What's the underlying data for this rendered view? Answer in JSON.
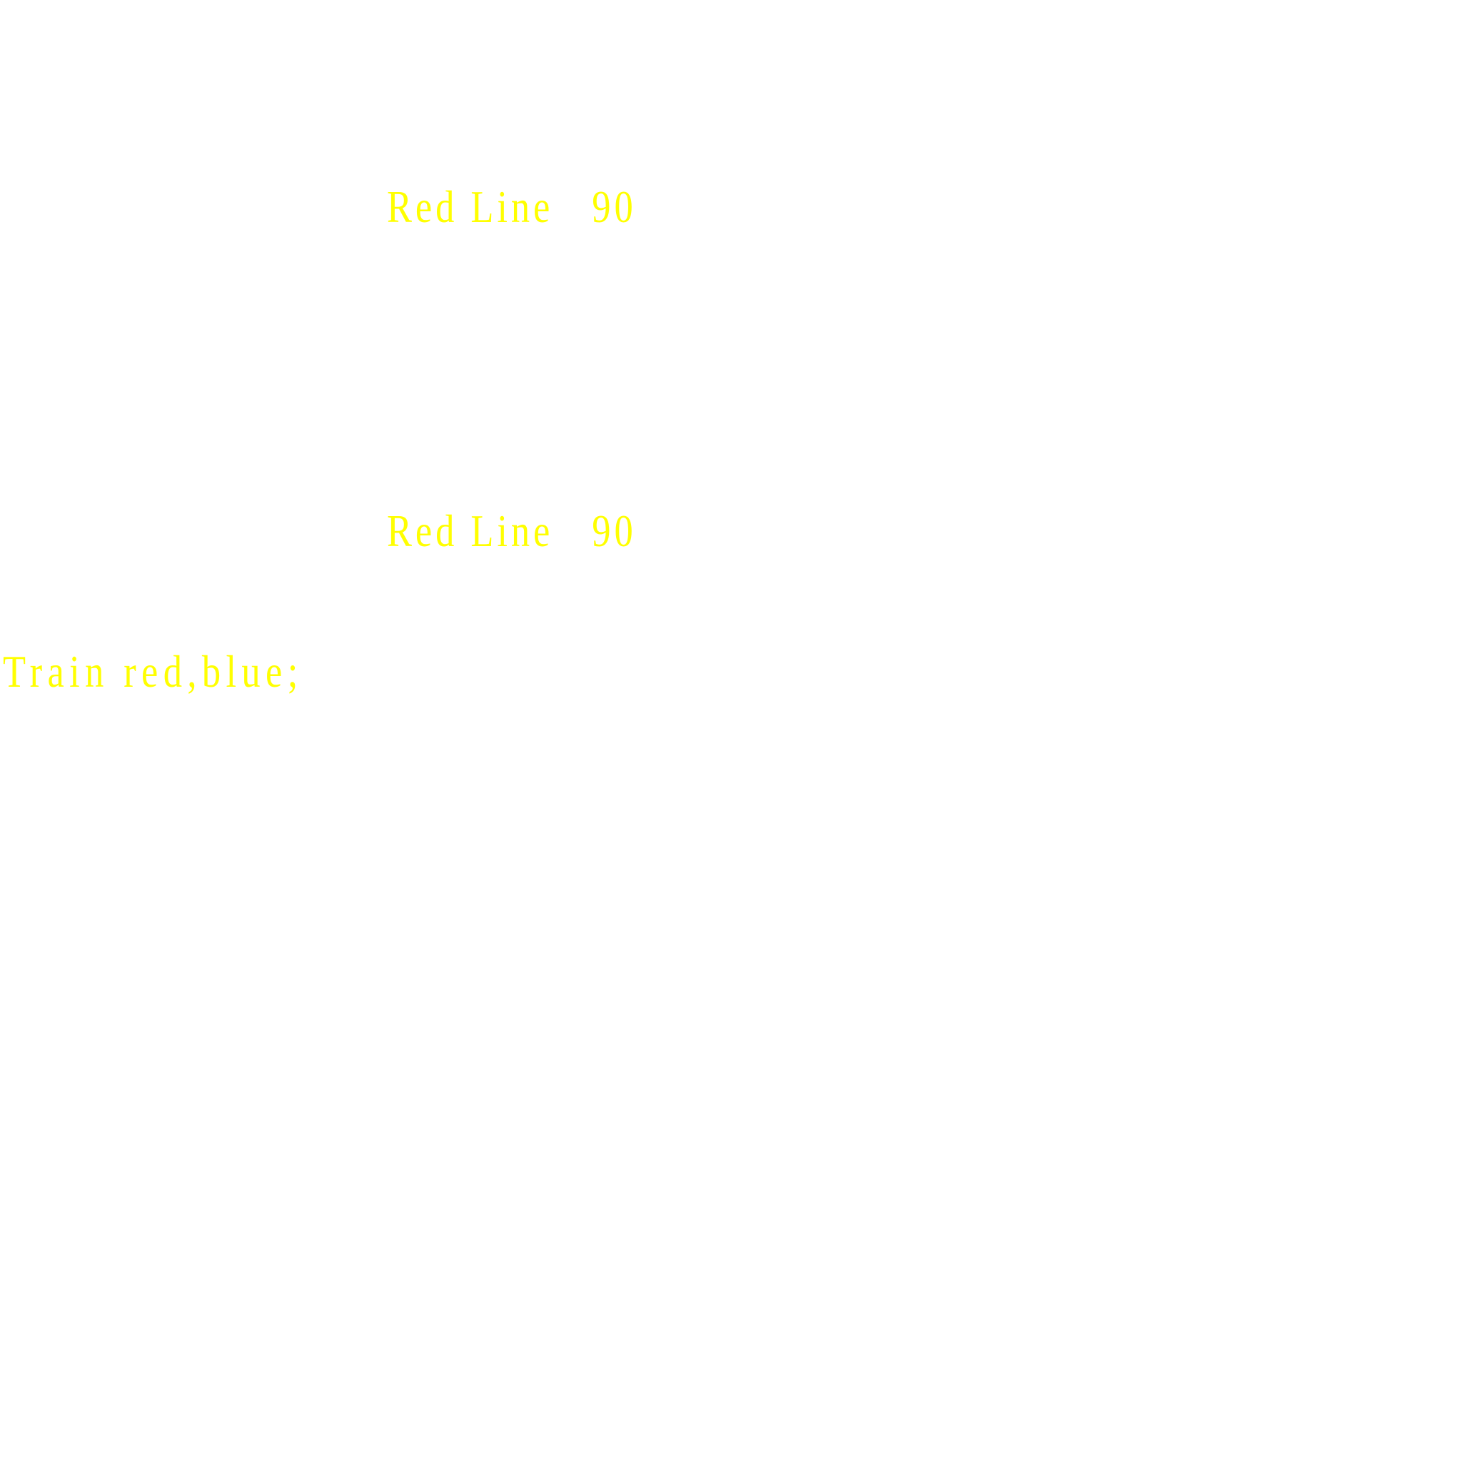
{
  "labels": [
    {
      "text": "Red Line   90"
    },
    {
      "text": "Red Line   90"
    },
    {
      "text": "Train red,blue;"
    }
  ],
  "colors": {
    "background": "#ffffff",
    "text": "#ffff00"
  }
}
